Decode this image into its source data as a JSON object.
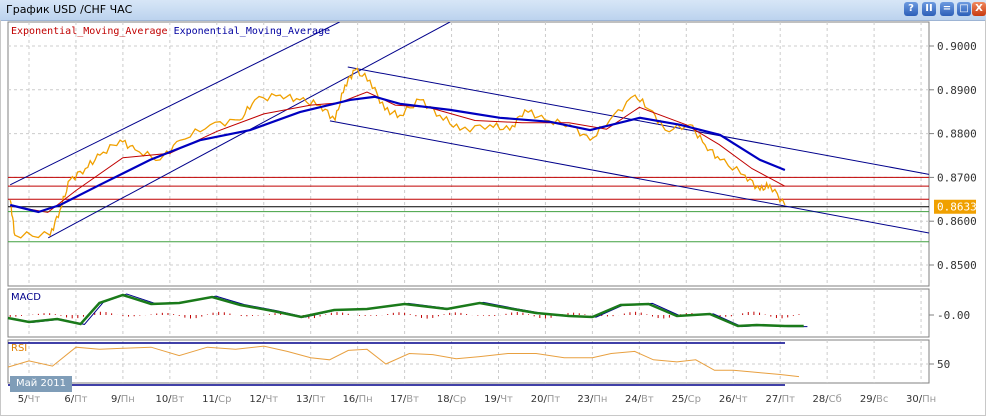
{
  "window": {
    "title": "График USD /CHF  ЧАС",
    "buttons": [
      "?",
      "II",
      "=",
      "□",
      "X"
    ]
  },
  "legend": [
    {
      "label": "Exponential_Moving_Average",
      "color": "#c00000"
    },
    {
      "label": "Exponential_Moving_Average",
      "color": "#0000a0"
    }
  ],
  "month_label": "Май 2011",
  "chart_data": {
    "type": "line",
    "title": "График USD /CHF  ЧАС",
    "ylim": [
      0.845,
      0.9035
    ],
    "yticks": [
      "0.9000",
      "0.8900",
      "0.8800",
      "0.8700",
      "0.8600",
      "0.8500"
    ],
    "ytick_values": [
      0.9,
      0.89,
      0.88,
      0.87,
      0.86,
      0.85
    ],
    "current_price": "0.8633",
    "x_labels": [
      [
        "5",
        "Чт"
      ],
      [
        "6",
        "Пт"
      ],
      [
        "9",
        "Пн"
      ],
      [
        "10",
        "Вт"
      ],
      [
        "11",
        "Ср"
      ],
      [
        "12",
        "Чт"
      ],
      [
        "13",
        "Пт"
      ],
      [
        "16",
        "Пн"
      ],
      [
        "17",
        "Вт"
      ],
      [
        "18",
        "Ср"
      ],
      [
        "19",
        "Чт"
      ],
      [
        "20",
        "Пт"
      ],
      [
        "23",
        "Пн"
      ],
      [
        "24",
        "Вт"
      ],
      [
        "25",
        "Ср"
      ],
      [
        "26",
        "Чт"
      ],
      [
        "27",
        "Пт"
      ],
      [
        "28",
        "Сб"
      ],
      [
        "29",
        "Вс"
      ],
      [
        "30",
        "Пн"
      ]
    ],
    "price": {
      "color": "#f0a000",
      "points": [
        [
          -0.4,
          0.8648
        ],
        [
          -0.3,
          0.8568
        ],
        [
          0.45,
          0.8568
        ],
        [
          0.66,
          0.8626
        ],
        [
          0.87,
          0.8694
        ],
        [
          1.2,
          0.872
        ],
        [
          1.51,
          0.8751
        ],
        [
          1.94,
          0.8785
        ],
        [
          2.26,
          0.8763
        ],
        [
          2.79,
          0.874
        ],
        [
          3.22,
          0.8785
        ],
        [
          3.86,
          0.882
        ],
        [
          4.49,
          0.8831
        ],
        [
          4.81,
          0.8877
        ],
        [
          5.35,
          0.8888
        ],
        [
          5.77,
          0.8877
        ],
        [
          6.2,
          0.8865
        ],
        [
          6.52,
          0.8831
        ],
        [
          6.73,
          0.8911
        ],
        [
          6.94,
          0.8945
        ],
        [
          7.26,
          0.8922
        ],
        [
          7.58,
          0.8854
        ],
        [
          7.9,
          0.8842
        ],
        [
          8.33,
          0.8877
        ],
        [
          8.75,
          0.8842
        ],
        [
          9.18,
          0.8808
        ],
        [
          9.82,
          0.882
        ],
        [
          10.24,
          0.8808
        ],
        [
          10.56,
          0.8854
        ],
        [
          10.99,
          0.8831
        ],
        [
          11.52,
          0.882
        ],
        [
          11.95,
          0.8785
        ],
        [
          12.37,
          0.8831
        ],
        [
          12.91,
          0.8888
        ],
        [
          13.23,
          0.8854
        ],
        [
          13.55,
          0.8808
        ],
        [
          14.08,
          0.882
        ],
        [
          14.4,
          0.8774
        ],
        [
          14.72,
          0.874
        ],
        [
          15.25,
          0.8705
        ],
        [
          15.57,
          0.8671
        ],
        [
          15.78,
          0.8683
        ],
        [
          16.1,
          0.8637
        ]
      ]
    },
    "ema_red": {
      "color": "#c00000",
      "points": [
        [
          -0.4,
          0.8635
        ],
        [
          0.4,
          0.862
        ],
        [
          1,
          0.867
        ],
        [
          2,
          0.8745
        ],
        [
          3,
          0.8755
        ],
        [
          4,
          0.8805
        ],
        [
          5,
          0.8845
        ],
        [
          6,
          0.8865
        ],
        [
          6.6,
          0.887
        ],
        [
          7.2,
          0.8895
        ],
        [
          7.8,
          0.8865
        ],
        [
          8.5,
          0.886
        ],
        [
          9.5,
          0.883
        ],
        [
          10.5,
          0.8825
        ],
        [
          11.5,
          0.8825
        ],
        [
          12.3,
          0.881
        ],
        [
          13,
          0.886
        ],
        [
          14,
          0.882
        ],
        [
          14.7,
          0.8775
        ],
        [
          15.4,
          0.872
        ],
        [
          16.1,
          0.868
        ]
      ]
    },
    "ema_blue": {
      "color": "#0000c0",
      "points": [
        [
          -0.4,
          0.8637
        ],
        [
          0.2,
          0.8621
        ],
        [
          0.66,
          0.8637
        ],
        [
          1.51,
          0.8683
        ],
        [
          2.58,
          0.874
        ],
        [
          3.64,
          0.8785
        ],
        [
          4.71,
          0.8808
        ],
        [
          5.77,
          0.8849
        ],
        [
          6.84,
          0.8877
        ],
        [
          7.37,
          0.8884
        ],
        [
          7.9,
          0.8868
        ],
        [
          8.97,
          0.8854
        ],
        [
          10.03,
          0.8836
        ],
        [
          11.1,
          0.8827
        ],
        [
          11.95,
          0.8808
        ],
        [
          13.01,
          0.8836
        ],
        [
          13.87,
          0.882
        ],
        [
          14.72,
          0.8797
        ],
        [
          15.57,
          0.874
        ],
        [
          16.1,
          0.8717
        ]
      ]
    },
    "hlines": [
      {
        "value": 0.87,
        "color": "#c00000"
      },
      {
        "value": 0.868,
        "color": "#c00000"
      },
      {
        "value": 0.865,
        "color": "#c00000"
      },
      {
        "value": 0.8633,
        "color": "#000000"
      },
      {
        "value": 0.8622,
        "color": "#40a040"
      },
      {
        "value": 0.8553,
        "color": "#40a040"
      }
    ],
    "channels": [
      {
        "from": [
          -0.4,
          0.8683
        ],
        "to": [
          6.62,
          0.9055
        ]
      },
      {
        "from": [
          0.41,
          0.8562
        ],
        "to": [
          8.97,
          0.9055
        ]
      },
      {
        "from": [
          6.79,
          0.8952
        ],
        "to": [
          19.17,
          0.8707
        ]
      },
      {
        "from": [
          6.41,
          0.8829
        ],
        "to": [
          19.17,
          0.8573
        ]
      }
    ],
    "macd": {
      "label": "MACD",
      "tick": "-0.00",
      "signal": [
        [
          -0.45,
          -0.15
        ],
        [
          0,
          -0.35
        ],
        [
          0.6,
          -0.2
        ],
        [
          1.1,
          -0.45
        ],
        [
          1.5,
          0.6
        ],
        [
          2,
          1
        ],
        [
          2.6,
          0.55
        ],
        [
          3.2,
          0.6
        ],
        [
          3.9,
          0.9
        ],
        [
          4.5,
          0.5
        ],
        [
          5.2,
          0.2
        ],
        [
          5.8,
          -0.1
        ],
        [
          6.5,
          0.25
        ],
        [
          7.2,
          0.3
        ],
        [
          8,
          0.55
        ],
        [
          8.9,
          0.3
        ],
        [
          9.6,
          0.6
        ],
        [
          10.3,
          0.3
        ],
        [
          10.8,
          0.1
        ],
        [
          11.5,
          -0.05
        ],
        [
          12,
          -0.1
        ],
        [
          12.6,
          0.5
        ],
        [
          13.2,
          0.55
        ],
        [
          13.8,
          -0.05
        ],
        [
          14.5,
          0.05
        ],
        [
          15.1,
          -0.55
        ],
        [
          15.5,
          -0.5
        ],
        [
          16.1,
          -0.55
        ],
        [
          16.5,
          -0.55
        ]
      ],
      "histogram_color": "#c00000",
      "line_color": "#1a7a1a"
    },
    "rsi": {
      "label": "RSI",
      "tick": "50",
      "levels": [
        70,
        30
      ],
      "values": [
        [
          -0.45,
          47
        ],
        [
          0,
          53
        ],
        [
          0.5,
          48
        ],
        [
          1,
          66
        ],
        [
          1.5,
          64
        ],
        [
          2,
          65
        ],
        [
          2.6,
          66
        ],
        [
          3.2,
          58
        ],
        [
          3.8,
          66
        ],
        [
          4.4,
          64
        ],
        [
          5,
          67
        ],
        [
          5.5,
          62
        ],
        [
          6,
          56
        ],
        [
          6.4,
          54
        ],
        [
          6.8,
          63
        ],
        [
          7.2,
          64
        ],
        [
          7.6,
          50
        ],
        [
          8.1,
          60
        ],
        [
          8.6,
          59
        ],
        [
          9.1,
          55
        ],
        [
          9.6,
          57
        ],
        [
          10.2,
          60
        ],
        [
          10.8,
          60
        ],
        [
          11.4,
          56
        ],
        [
          12,
          56
        ],
        [
          12.4,
          60
        ],
        [
          12.9,
          62
        ],
        [
          13.3,
          54
        ],
        [
          13.8,
          52
        ],
        [
          14.2,
          54
        ],
        [
          14.6,
          44
        ],
        [
          15,
          44
        ],
        [
          15.5,
          42
        ],
        [
          16,
          40
        ],
        [
          16.4,
          38
        ]
      ]
    }
  }
}
